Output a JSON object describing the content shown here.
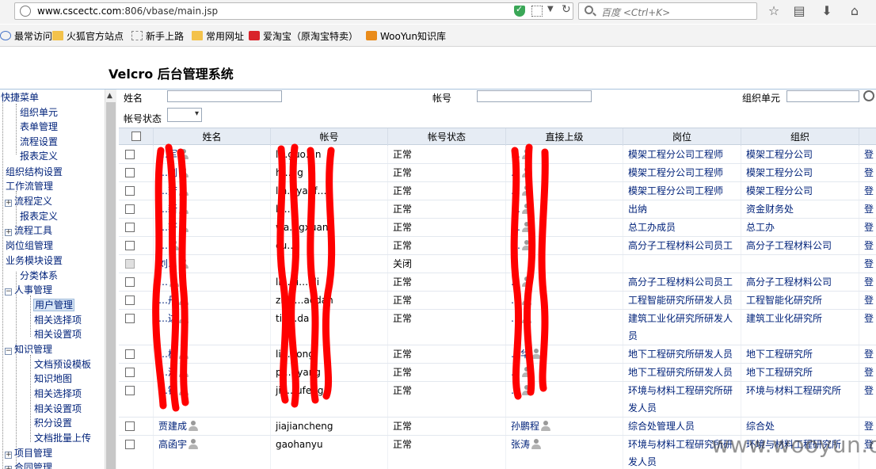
{
  "browser": {
    "url_host": "www.cscectc.com",
    "url_rest": ":806/vbase/main.jsp",
    "search_placeholder": "百度 <Ctrl+K>",
    "bookmarks": [
      {
        "label": "最常访问",
        "icon": "globe-icon"
      },
      {
        "label": "火狐官方站点",
        "icon": "folder-icon"
      },
      {
        "label": "新手上路",
        "icon": "dashed-page-icon"
      },
      {
        "label": "常用网址",
        "icon": "folder-icon"
      },
      {
        "label": "爱淘宝（原淘宝特卖）",
        "icon": "taobao-icon"
      },
      {
        "label": "WooYun知识库",
        "icon": "rss-icon"
      }
    ]
  },
  "header": {
    "title": "Velcro 后台管理系统"
  },
  "tree": [
    {
      "label": "快捷菜单"
    },
    {
      "label": "组织单元"
    },
    {
      "label": "表单管理"
    },
    {
      "label": "流程设置"
    },
    {
      "label": "报表定义"
    },
    {
      "label": "组织结构设置"
    },
    {
      "label": "工作流管理"
    },
    {
      "label": "流程定义"
    },
    {
      "label": "报表定义"
    },
    {
      "label": "流程工具"
    },
    {
      "label": "岗位组管理"
    },
    {
      "label": "业务模块设置"
    },
    {
      "label": "分类体系"
    },
    {
      "label": "人事管理"
    },
    {
      "label": "用户管理"
    },
    {
      "label": "相关选择项"
    },
    {
      "label": "相关设置项"
    },
    {
      "label": "知识管理"
    },
    {
      "label": "文档预设模板"
    },
    {
      "label": "知识地图"
    },
    {
      "label": "相关选择项"
    },
    {
      "label": "相关设置项"
    },
    {
      "label": "积分设置"
    },
    {
      "label": "文档批量上传"
    },
    {
      "label": "项目管理"
    },
    {
      "label": "合同管理"
    }
  ],
  "filters": {
    "name_label": "姓名",
    "account_label": "帐号",
    "org_label": "组织单元",
    "status_label": "帐号状态"
  },
  "grid": {
    "columns": [
      "姓名",
      "帐号",
      "帐号状态",
      "直接上级",
      "岗位",
      "组织"
    ],
    "rows": [
      {
        "name": "…军",
        "account": "l…guo…n",
        "status": "正常",
        "manager": "…",
        "post": "模架工程分公司工程师",
        "org": "模架工程分公司",
        "extra": "登"
      },
      {
        "name": "…刚",
        "account": "h…ng",
        "status": "正常",
        "manager": "…",
        "post": "模架工程分公司工程师",
        "org": "模架工程分公司",
        "extra": "登"
      },
      {
        "name": "…芳",
        "account": "lin…yanf…g",
        "status": "正常",
        "manager": "…",
        "post": "模架工程分公司工程师",
        "org": "模架工程分公司",
        "extra": "登"
      },
      {
        "name": "…新",
        "account": "li…n",
        "status": "正常",
        "manager": "…",
        "post": "出纳",
        "org": "资金财务处",
        "extra": "登"
      },
      {
        "name": "…轩",
        "account": "wa…gxuan",
        "status": "正常",
        "manager": "…",
        "post": "总工办成员",
        "org": "总工办",
        "extra": "登"
      },
      {
        "name": "…",
        "account": "cu…",
        "status": "正常",
        "manager": "…",
        "post": "高分子工程材料公司员工",
        "org": "高分子工程材料公司",
        "extra": "登"
      },
      {
        "name": "刘…",
        "account": "",
        "status": "关闭",
        "manager": "",
        "post": "",
        "org": "",
        "extra": "登",
        "disabled": true
      },
      {
        "name": "…",
        "account": "li…xi…oli",
        "status": "正常",
        "manager": "…",
        "post": "高分子工程材料公司员工",
        "org": "高分子工程材料公司",
        "extra": "登"
      },
      {
        "name": "…丹",
        "account": "zhis…aodan",
        "status": "正常",
        "manager": "…",
        "post": "工程智能研究所研发人员",
        "org": "工程智能化研究所",
        "extra": "登"
      },
      {
        "name": "…达",
        "account": "tia…da",
        "status": "正常",
        "manager": "…",
        "post": "建筑工业化研究所研发人员",
        "org": "建筑工业化研究所",
        "extra": "登"
      },
      {
        "name": "…栋",
        "account": "li…dong",
        "status": "正常",
        "manager": "…华",
        "post": "地下工程研究所研发人员",
        "org": "地下工程研究所",
        "extra": "登"
      },
      {
        "name": "…洋",
        "account": "p…gyang",
        "status": "正常",
        "manager": "…",
        "post": "地下工程研究所研发人员",
        "org": "地下工程研究所",
        "extra": "登"
      },
      {
        "name": "…锋",
        "account": "jia…ufeng",
        "status": "正常",
        "manager": "…",
        "post": "环境与材料工程研究所研发人员",
        "org": "环境与材料工程研究所",
        "extra": "登"
      },
      {
        "name": "贾建成",
        "account": "jiajiancheng",
        "status": "正常",
        "manager": "孙鹏程",
        "post": "综合处管理人员",
        "org": "综合处",
        "extra": "登"
      },
      {
        "name": "高函宇",
        "account": "gaohanyu",
        "status": "正常",
        "manager": "张涛",
        "post": "环境与材料工程研究所研发人员",
        "org": "环境与材料工程研究所",
        "extra": "登"
      }
    ]
  },
  "watermark": "www.wooyun.org",
  "colors": {
    "link": "#00227a",
    "header_bg": "#e6ecf4",
    "redaction": "#ff0000"
  }
}
